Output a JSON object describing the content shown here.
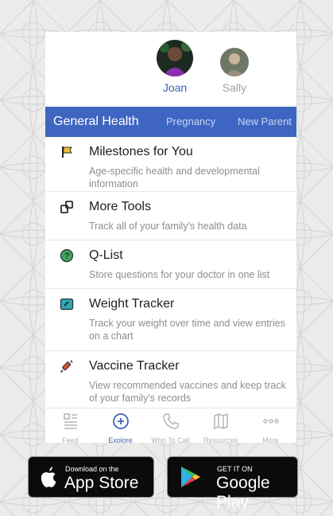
{
  "profiles": [
    {
      "name": "Joan",
      "selected": true
    },
    {
      "name": "Sally",
      "selected": false
    }
  ],
  "tabs": [
    {
      "label": "General Health",
      "active": true
    },
    {
      "label": "Pregnancy",
      "active": false
    },
    {
      "label": "New Parent",
      "active": false
    }
  ],
  "items": [
    {
      "title": "Milestones for You",
      "desc": "Age-specific health and developmental information",
      "icon": "flag-icon"
    },
    {
      "title": "More Tools",
      "desc": "Track all of your family's health data",
      "icon": "tools-icon"
    },
    {
      "title": "Q-List",
      "desc": "Store questions for your doctor in one list",
      "icon": "question-icon"
    },
    {
      "title": "Weight Tracker",
      "desc": "Track your weight over time and view entries on a chart",
      "icon": "scale-icon"
    },
    {
      "title": "Vaccine Tracker",
      "desc": "View recommended vaccines and keep track of your family's records",
      "icon": "syringe-icon"
    }
  ],
  "bottom_nav": [
    {
      "label": "Feed",
      "icon": "feed-icon",
      "active": false
    },
    {
      "label": "Explore",
      "icon": "explore-icon",
      "active": true
    },
    {
      "label": "Who To Call",
      "icon": "phone-icon",
      "active": false
    },
    {
      "label": "Resources",
      "icon": "map-icon",
      "active": false
    },
    {
      "label": "More",
      "icon": "more-icon",
      "active": false
    }
  ],
  "badges": {
    "apple": {
      "small": "Download on the",
      "big": "App Store"
    },
    "google": {
      "small": "GET IT ON",
      "big": "Google Play"
    }
  },
  "colors": {
    "primary": "#3e65c1",
    "flag": "#f2c12e",
    "qlist": "#3fa65a",
    "weight": "#2aa9b8",
    "vaccine": "#d9542f"
  }
}
